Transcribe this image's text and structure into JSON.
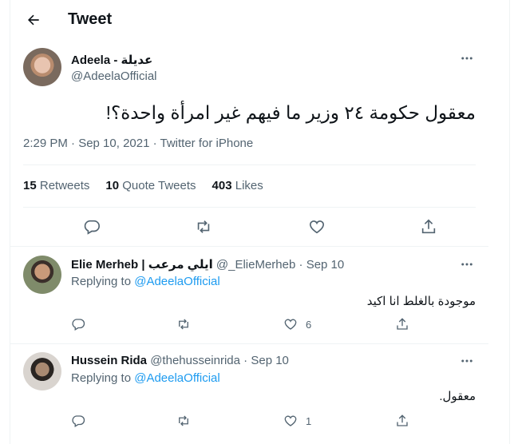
{
  "header": {
    "title": "Tweet"
  },
  "tweet": {
    "author_name": "Adeela - عديلة",
    "author_handle": "@AdeelaOfficial",
    "text": "معقول حكومة ٢٤ وزير ما فيهم غير امرأة واحدة؟!",
    "meta": "2:29 PM · Sep 10, 2021 · Twitter for iPhone",
    "stats": {
      "retweets_count": "15",
      "retweets_label": "Retweets",
      "quotes_count": "10",
      "quotes_label": "Quote Tweets",
      "likes_count": "403",
      "likes_label": "Likes"
    }
  },
  "replies": [
    {
      "name": "Elie Merheb | ايلي مرعب",
      "handle": "@_ElieMerheb",
      "date": "Sep 10",
      "replying_prefix": "Replying to",
      "replying_handle": "@AdeelaOfficial",
      "text": "موجودة بالغلط انا اكيد",
      "likes": "6"
    },
    {
      "name": "Hussein Rida",
      "handle": "@thehusseinrida",
      "date": "Sep 10",
      "replying_prefix": "Replying to",
      "replying_handle": "@AdeelaOfficial",
      "text": "معقول.",
      "likes": "1"
    }
  ],
  "icons": [
    "back-arrow-icon",
    "more-icon",
    "reply-icon",
    "retweet-icon",
    "like-icon",
    "share-icon"
  ]
}
